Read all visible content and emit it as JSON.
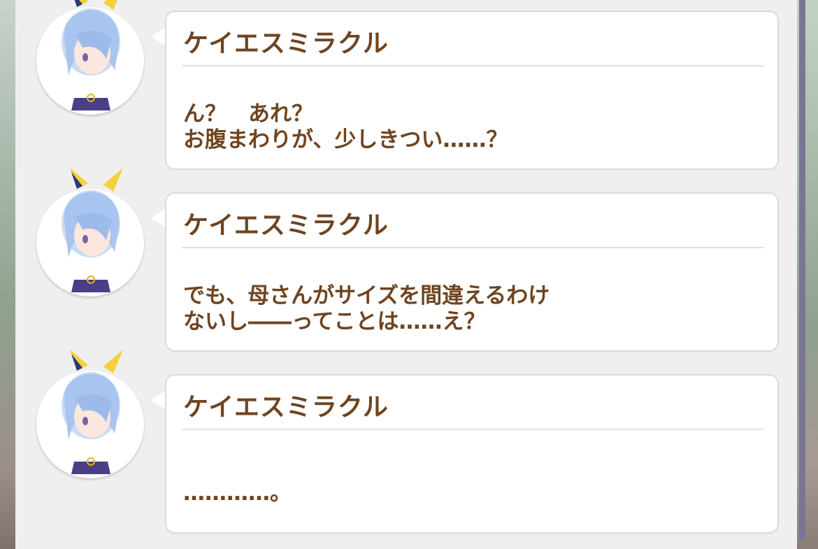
{
  "dialogue_log": {
    "entries": [
      {
        "speaker": "ケイエスミラクル",
        "avatar_icon": "character-portrait-icon",
        "lines": [
          "ん？　あれ？",
          "お腹まわりが、少しきつい……？"
        ]
      },
      {
        "speaker": "ケイエスミラクル",
        "avatar_icon": "character-portrait-icon",
        "lines": [
          "でも、母さんがサイズを間違えるわけ",
          "ないし――ってことは……え？"
        ]
      },
      {
        "speaker": "ケイエスミラクル",
        "avatar_icon": "character-portrait-icon",
        "lines": [
          "…………。"
        ]
      }
    ]
  },
  "colors": {
    "text_brown": "#6e4420",
    "panel_bg": "#efefef",
    "scrollbar": "#7a7595"
  }
}
